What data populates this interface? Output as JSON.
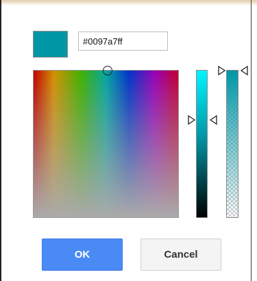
{
  "color_picker": {
    "current_color": "#0097a7",
    "hex_value": "#0097a7ff",
    "buttons": {
      "ok_label": "OK",
      "cancel_label": "Cancel"
    }
  }
}
